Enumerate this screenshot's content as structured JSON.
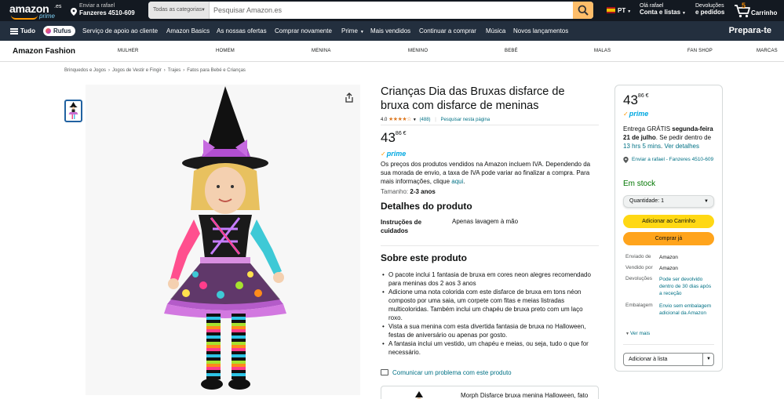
{
  "header": {
    "logo_word": "amazon",
    "logo_tld": ".es",
    "logo_prime": "prime",
    "deliver_line1": "Enviar a rafael",
    "deliver_line2": "Fanzeres 4510-609",
    "search_category": "Todas as categorias",
    "search_placeholder": "Pesquisar Amazon.es",
    "language": "PT",
    "account_line1": "Olá rafael",
    "account_line2": "Conta e listas",
    "orders_line1": "Devoluções",
    "orders_line2": "e pedidos",
    "cart_count": "5",
    "cart_label": "Carrinho"
  },
  "subnav": {
    "all_label": "Tudo",
    "rufus_label": "Rufus",
    "items": [
      "Serviço de apoio ao cliente",
      "Amazon Basics",
      "As nossas ofertas",
      "Comprar novamente",
      "Prime",
      "Mais vendidos",
      "Continuar a comprar",
      "Música",
      "Novos lançamentos"
    ],
    "promo": "Prepara-te"
  },
  "category_bar": {
    "brand": "Amazon Fashion",
    "items": [
      "MULHER",
      "HOMEM",
      "MENINA",
      "MENINO",
      "BEBÉ",
      "MALAS",
      "FAN SHOP",
      "MARCAS"
    ]
  },
  "breadcrumbs": [
    "Brinquedos e Jogos",
    "Jogos de Vestir e Fingir",
    "Trajes",
    "Fatos para Bebé e Crianças"
  ],
  "product": {
    "title": "Crianças Dia das Bruxas disfarce de bruxa com disfarce de meninas",
    "rating_value": "4.0",
    "rating_stars": "★★★★☆",
    "rating_count": "(488)",
    "search_page_link": "Pesquisar nesta página",
    "price_whole": "43",
    "price_fraction": "86",
    "price_currency": "€",
    "prime_label": "prime",
    "iva_text": "Os preços dos produtos vendidos na Amazon incluem IVA. Dependendo da sua morada de envio, a taxa de IVA pode variar ao finalizar a compra. Para mais informações, clique ",
    "iva_link": "aqui",
    "iva_end": ".",
    "size_label": "Tamanho:",
    "size_value": "2-3 anos",
    "details_heading": "Detalhes do produto",
    "details_key": "Instruções de cuidados",
    "details_value": "Apenas lavagem à mão",
    "about_heading": "Sobre este produto",
    "bullets": [
      "O pacote inclui 1 fantasia de bruxa em cores neon alegres recomendado para meninas dos 2 aos 3 anos",
      "Adicione uma nota colorida com este disfarce de bruxa em tons néon composto por uma saia, um corpete com fitas e meias listradas multicoloridas. Também inclui um chapéu de bruxa preto com um laço roxo.",
      "Vista a sua menina com esta divertida fantasia de bruxa no Halloween, festas de aniversário ou apenas por gosto.",
      "A fantasia inclui um vestido, um chapéu e meias, ou seja, tudo o que for necessário."
    ],
    "report_link": "Comunicar um problema com este produto",
    "related_title": "Morph Disfarce bruxa menina Halloween, fato"
  },
  "buybox": {
    "price_whole": "43",
    "price_fraction": "86",
    "price_currency": "€",
    "prime_label": "prime",
    "delivery_pre": "Entrega GRÁTIS ",
    "delivery_date": "segunda-feira 21 de julho",
    "delivery_mid": ". Se pedir dentro de ",
    "delivery_time": "13 hrs 5 mins",
    "delivery_dot": ". ",
    "delivery_link": "Ver detalhes",
    "ship_to": "Enviar a rafael - Fanzeres 4510-609",
    "stock": "Em stock",
    "qty_label": "Quantidade:",
    "qty_value": "1",
    "add_to_cart": "Adicionar ao Carrinho",
    "buy_now": "Comprar já",
    "meta": [
      {
        "k": "Enviado de",
        "v": "Amazon",
        "link": false
      },
      {
        "k": "Vendido por",
        "v": "Amazon",
        "link": false
      },
      {
        "k": "Devoluções",
        "v": "Pode ser devolvido dentro de 30 dias após a receção",
        "link": true
      },
      {
        "k": "Embalagem",
        "v": "Envio sem embalagem adicional da Amazon",
        "link": true
      }
    ],
    "see_more": "Ver mais",
    "add_to_list": "Adicionar à lista"
  },
  "colors": {
    "nav_dark": "#131921",
    "nav_sub": "#232f3e",
    "search_btn": "#febd69",
    "add_cart": "#ffd814",
    "buy_now": "#ffa41c",
    "link": "#007185",
    "in_stock": "#007600"
  }
}
